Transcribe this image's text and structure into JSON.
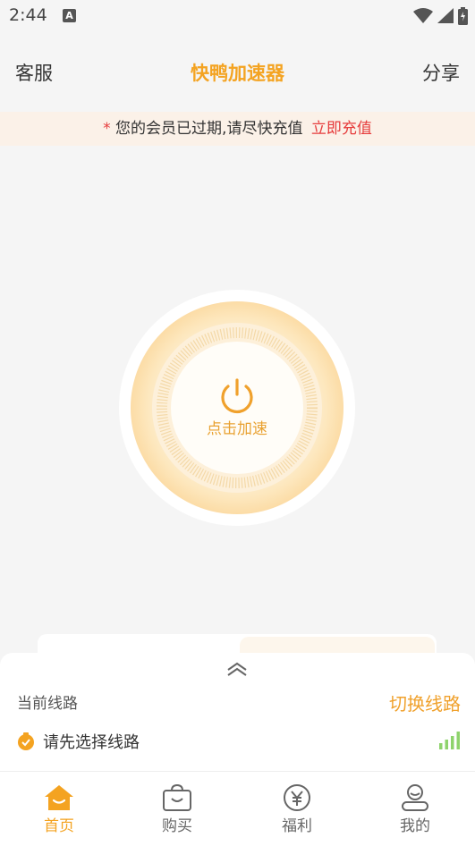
{
  "status_bar": {
    "time": "2:44",
    "notif_letter": "A"
  },
  "header": {
    "left": "客服",
    "title": "快鸭加速器",
    "right": "分享"
  },
  "notice": {
    "star": "*",
    "text": "您的会员已过期,请尽快充值",
    "link": "立即充值"
  },
  "power": {
    "label": "点击加速"
  },
  "route_card": {
    "title": "当前线路",
    "switch_label": "切换线路",
    "route_placeholder": "请先选择线路"
  },
  "tabs": [
    {
      "label": "首页",
      "icon": "home-icon",
      "active": true
    },
    {
      "label": "购买",
      "icon": "shopping-bag-icon",
      "active": false
    },
    {
      "label": "福利",
      "icon": "yen-icon",
      "active": false
    },
    {
      "label": "我的",
      "icon": "profile-icon",
      "active": false
    }
  ],
  "colors": {
    "accent": "#f4a321",
    "alert": "#e63c3c",
    "signal": "#8ed36c"
  }
}
